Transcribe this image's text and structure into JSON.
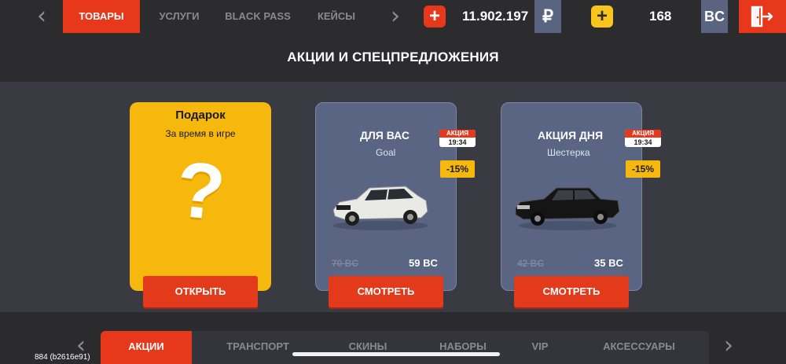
{
  "topbar": {
    "tabs": [
      "ТОВАРЫ",
      "УСЛУГИ",
      "BLACK PASS",
      "КЕЙСЫ"
    ],
    "balance_rub": "11.902.197",
    "rub_symbol": "₽",
    "balance_bc": "168",
    "bc_label": "BC",
    "icons": {
      "prev": "chevron-left-icon",
      "next": "chevron-right-icon",
      "add": "plus-icon",
      "exit": "exit-door-icon"
    }
  },
  "header": {
    "title": "АКЦИИ И СПЕЦПРЕДЛОЖЕНИЯ"
  },
  "cards": {
    "gift": {
      "title": "Подарок",
      "subtitle": "За время в игре",
      "mark": "?",
      "button": "ОТКРЫТЬ"
    },
    "offer1": {
      "title": "ДЛЯ ВАС",
      "subtitle": "Goal",
      "badge_label": "АКЦИЯ",
      "badge_time": "19:34",
      "discount": "-15%",
      "old_price": "70 BC",
      "new_price": "59 BC",
      "button": "СМОТРЕТЬ",
      "car_color": "#e9e9e6"
    },
    "offer2": {
      "title": "АКЦИЯ ДНЯ",
      "subtitle": "Шестерка",
      "badge_label": "АКЦИЯ",
      "badge_time": "19:34",
      "discount": "-15%",
      "old_price": "42 BC",
      "new_price": "35 BC",
      "button": "СМОТРЕТЬ",
      "car_color": "#151515"
    }
  },
  "bottom_nav": {
    "tabs": [
      "АКЦИИ",
      "ТРАНСПОРТ",
      "СКИНЫ",
      "НАБОРЫ",
      "VIP",
      "АКСЕССУАРЫ"
    ]
  },
  "version": "884 (b2616e91)",
  "colors": {
    "accent": "#e8381b",
    "gold": "#f6b80c",
    "card": "#5a6483",
    "bg": "#2b2b2d"
  }
}
